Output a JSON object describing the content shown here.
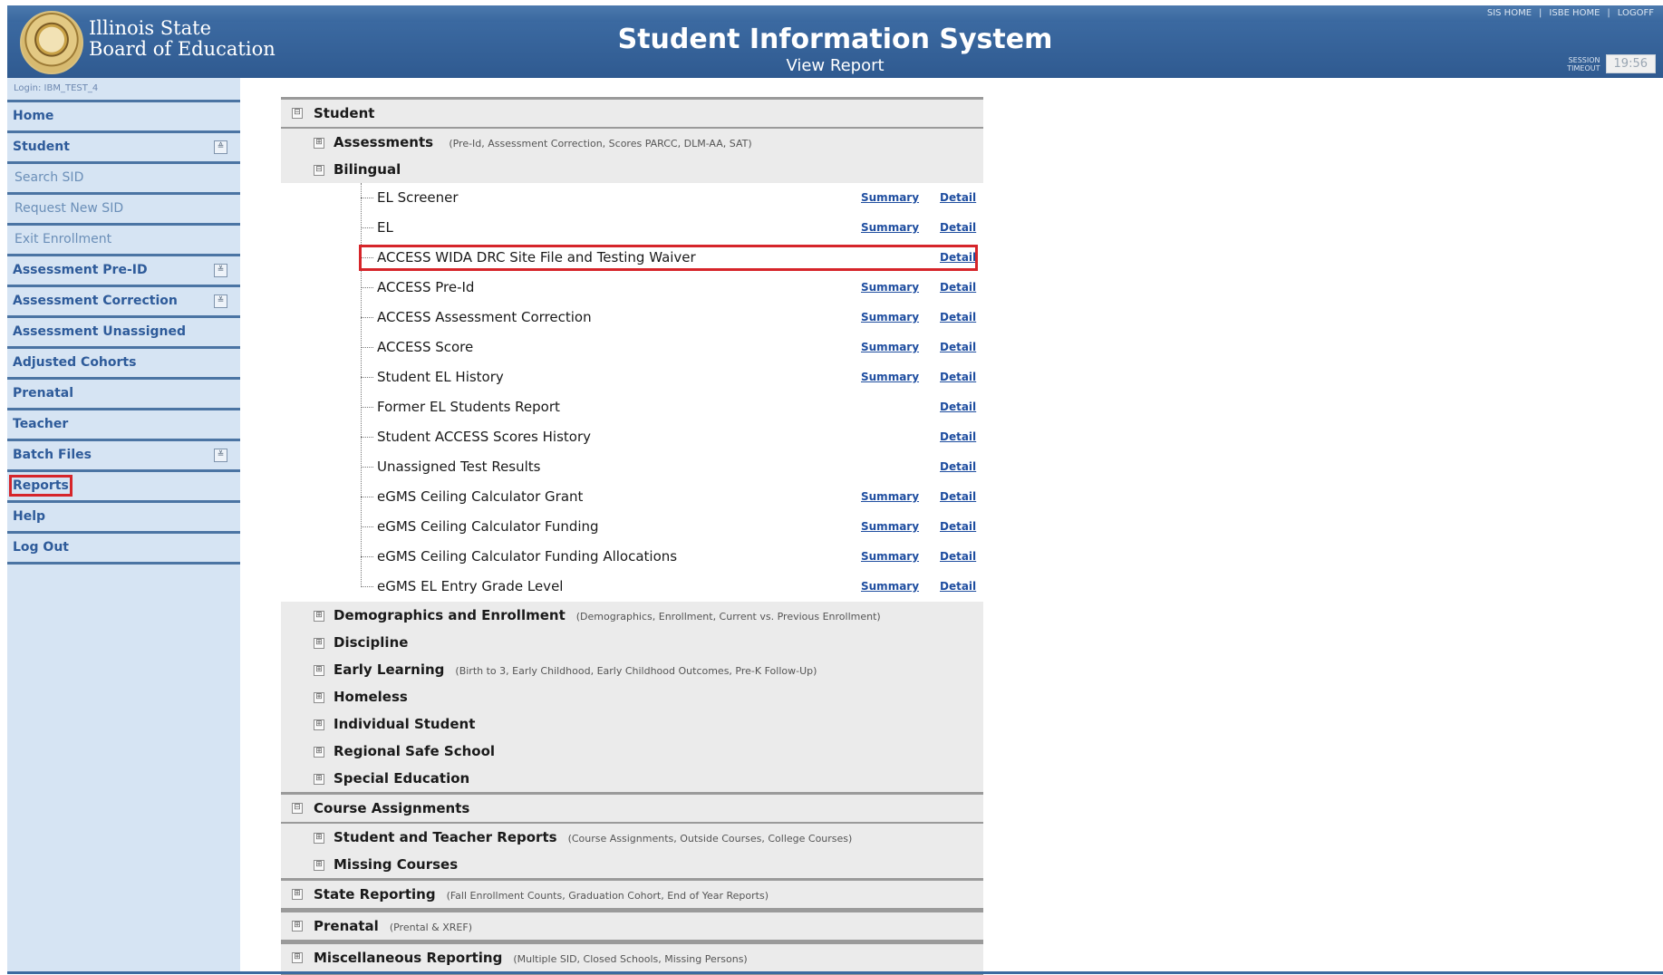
{
  "header": {
    "logo_line1": "Illinois State",
    "logo_line2": "Board of Education",
    "title": "Student Information System",
    "subtitle": "View Report",
    "top_links": [
      "SIS HOME",
      "ISBE HOME",
      "LOGOFF"
    ],
    "session_label_1": "SESSION",
    "session_label_2": "TIMEOUT",
    "session_time": "19:56"
  },
  "sidebar": {
    "login": "Login: IBM_TEST_4",
    "items": [
      {
        "label": "Home",
        "type": "main"
      },
      {
        "label": "Student",
        "type": "main",
        "toggle": "collapse"
      },
      {
        "label": "Search SID",
        "type": "sub"
      },
      {
        "label": "Request New SID",
        "type": "sub"
      },
      {
        "label": "Exit Enrollment",
        "type": "sub"
      },
      {
        "label": "Assessment Pre-ID",
        "type": "main",
        "toggle": "expand"
      },
      {
        "label": "Assessment Correction",
        "type": "main",
        "toggle": "expand"
      },
      {
        "label": "Assessment Unassigned",
        "type": "main"
      },
      {
        "label": "Adjusted Cohorts",
        "type": "main"
      },
      {
        "label": "Prenatal",
        "type": "main"
      },
      {
        "label": "Teacher",
        "type": "main"
      },
      {
        "label": "Batch Files",
        "type": "main",
        "toggle": "expand"
      },
      {
        "label": "Reports",
        "type": "main",
        "highlighted": true
      },
      {
        "label": "Help",
        "type": "main"
      },
      {
        "label": "Log Out",
        "type": "main"
      }
    ]
  },
  "tree": {
    "student": {
      "label": "Student",
      "assessments": {
        "label": "Assessments",
        "desc": "(Pre-Id, Assessment Correction, Scores PARCC, DLM-AA, SAT)"
      },
      "bilingual": {
        "label": "Bilingual",
        "reports": [
          {
            "name": "EL Screener",
            "summary": "Summary",
            "detail": "Detail"
          },
          {
            "name": "EL",
            "summary": "Summary",
            "detail": "Detail"
          },
          {
            "name": "ACCESS WIDA DRC Site File and Testing Waiver",
            "summary": "",
            "detail": "Detail",
            "highlighted": true
          },
          {
            "name": "ACCESS Pre-Id",
            "summary": "Summary",
            "detail": "Detail"
          },
          {
            "name": "ACCESS Assessment Correction",
            "summary": "Summary",
            "detail": "Detail"
          },
          {
            "name": "ACCESS Score",
            "summary": "Summary",
            "detail": "Detail"
          },
          {
            "name": "Student EL History",
            "summary": "Summary",
            "detail": "Detail"
          },
          {
            "name": "Former EL Students Report",
            "summary": "",
            "detail": "Detail"
          },
          {
            "name": "Student ACCESS Scores History",
            "summary": "",
            "detail": "Detail"
          },
          {
            "name": "Unassigned Test Results",
            "summary": "",
            "detail": "Detail"
          },
          {
            "name": "eGMS Ceiling Calculator Grant",
            "summary": "Summary",
            "detail": "Detail"
          },
          {
            "name": "eGMS Ceiling Calculator Funding",
            "summary": "Summary",
            "detail": "Detail"
          },
          {
            "name": "eGMS Ceiling Calculator Funding Allocations",
            "summary": "Summary",
            "detail": "Detail"
          },
          {
            "name": "eGMS EL Entry Grade Level",
            "summary": "Summary",
            "detail": "Detail"
          }
        ]
      },
      "others": [
        {
          "label": "Demographics and Enrollment",
          "desc": "(Demographics, Enrollment, Current vs. Previous Enrollment)"
        },
        {
          "label": "Discipline",
          "desc": ""
        },
        {
          "label": "Early Learning",
          "desc": "(Birth to 3, Early Childhood, Early Childhood Outcomes, Pre-K Follow-Up)"
        },
        {
          "label": "Homeless",
          "desc": ""
        },
        {
          "label": "Individual Student",
          "desc": ""
        },
        {
          "label": "Regional Safe School",
          "desc": ""
        },
        {
          "label": "Special Education",
          "desc": ""
        }
      ]
    },
    "course_assignments": {
      "label": "Course Assignments",
      "children": [
        {
          "label": "Student and Teacher Reports",
          "desc": "(Course Assignments, Outside Courses, College Courses)"
        },
        {
          "label": "Missing Courses",
          "desc": ""
        }
      ]
    },
    "bottom_sections": [
      {
        "label": "State Reporting",
        "desc": "(Fall Enrollment Counts, Graduation Cohort, End of Year Reports)"
      },
      {
        "label": "Prenatal",
        "desc": "(Prental & XREF)"
      },
      {
        "label": "Miscellaneous Reporting",
        "desc": "(Multiple SID, Closed Schools, Missing Persons)"
      }
    ]
  },
  "icons": {
    "expand": "⊞",
    "collapse": "⊟",
    "nav_expand": "≚",
    "nav_collapse": "≙"
  },
  "colors": {
    "header_blue": "#2f5a90",
    "sidebar_bg": "#d6e4f3",
    "link_blue": "#1f4ea0",
    "highlight_red": "#d6252a"
  }
}
